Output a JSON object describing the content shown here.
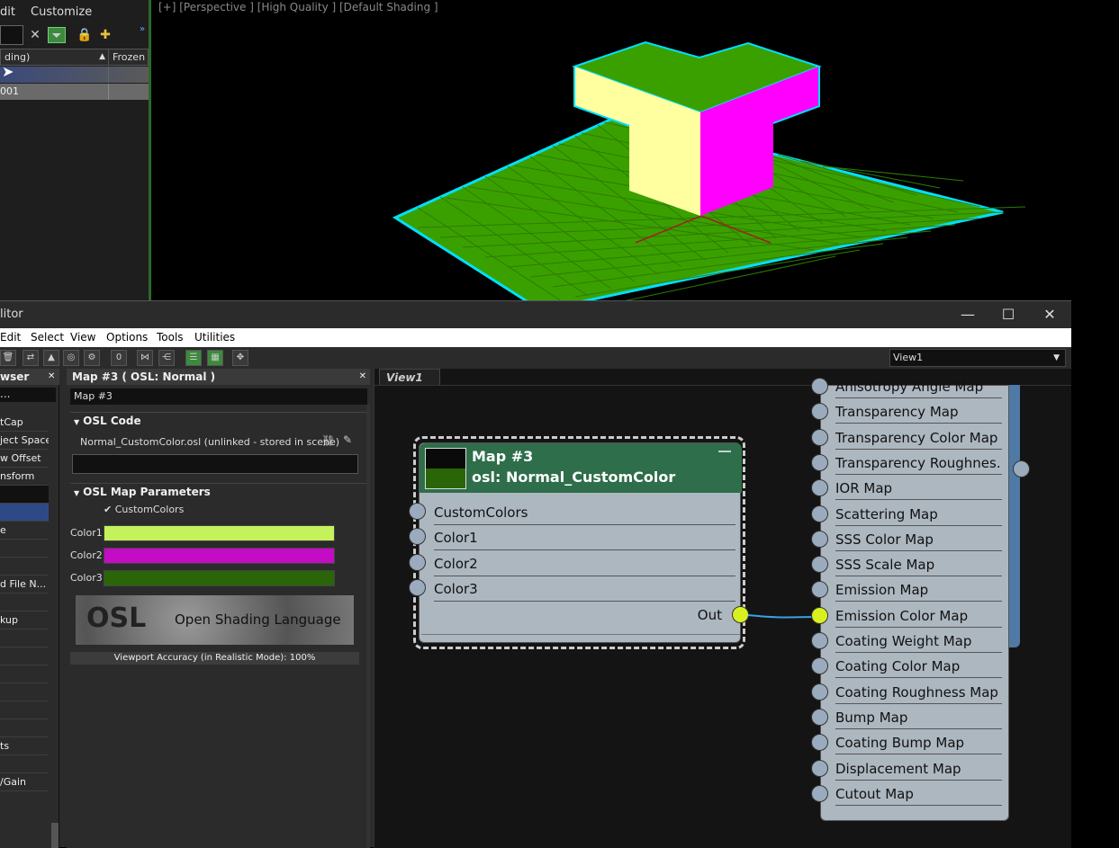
{
  "explorer": {
    "menu": [
      "dit",
      "Customize"
    ],
    "columns": {
      "name": "ding)",
      "frozen": "Frozen"
    },
    "rows": [
      "",
      "001"
    ]
  },
  "viewport": {
    "label": "[+] [Perspective ] [High Quality ] [Default Shading ]"
  },
  "editor": {
    "title": "litor",
    "menu": [
      "Edit",
      "Select",
      "View",
      "Options",
      "Tools",
      "Utilities"
    ],
    "view_select": "View1",
    "browser": {
      "header": "wser",
      "search": "...",
      "items": [
        "tCap",
        "ject Space",
        "w Offset",
        "nsform",
        "",
        "",
        "e",
        "",
        "",
        "d File N...",
        "",
        "kup",
        "",
        "",
        "",
        "",
        "",
        "",
        "ts",
        "",
        "/Gain"
      ]
    },
    "params": {
      "header": "Map #3  ( OSL: Normal )",
      "name": "Map #3",
      "osl_code_title": "OSL Code",
      "osl_file": "Normal_CustomColor.osl (unlinked - stored in scene)",
      "map_params_title": "OSL Map Parameters",
      "checkbox_label": "CustomColors",
      "colors": [
        {
          "label": "Color1",
          "hex": "#c4f25a"
        },
        {
          "label": "Color2",
          "hex": "#c40cc4"
        },
        {
          "label": "Color3",
          "hex": "#2a6608"
        }
      ],
      "osl_logo_text": "Open Shading Language",
      "accuracy": "Viewport Accuracy (in Realistic Mode): 100%"
    },
    "canvas": {
      "tab": "View1",
      "node": {
        "title1": "Map #3",
        "title2": "osl: Normal_CustomColor",
        "inputs": [
          "CustomColors",
          "Color1",
          "Color2",
          "Color3"
        ],
        "output": "Out"
      },
      "material_slots": [
        "Anisotropy Angle Map",
        "Transparency Map",
        "Transparency Color Map",
        "Transparency  Roughnes...",
        "IOR Map",
        "Scattering Map",
        "SSS Color Map",
        "SSS Scale Map",
        "Emission Map",
        "Emission Color Map",
        "Coating Weight Map",
        "Coating Color Map",
        "Coating Roughness Map",
        "Bump Map",
        "Coating Bump Map",
        "Displacement Map",
        "Cutout Map"
      ]
    }
  }
}
